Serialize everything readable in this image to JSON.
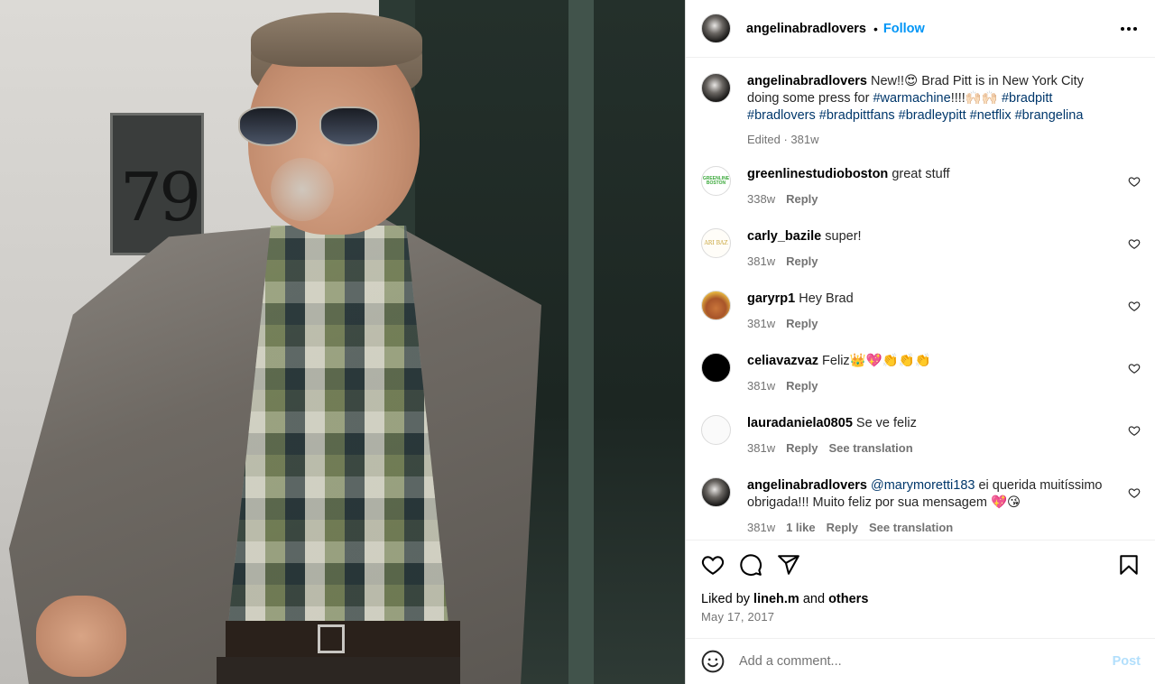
{
  "post": {
    "author": "angelinabradlovers",
    "follow_label": "Follow",
    "dot": "•"
  },
  "caption": {
    "username": "angelinabradlovers",
    "text_start": "New!!😍 Brad Pitt is in New York City doing some press for ",
    "tag1": "#warmachine",
    "text_mid": "!!!!🙌🏻🙌🏻 ",
    "tags_rest": "#bradpitt #bradlovers #bradpittfans #bradleypitt #netflix #brangelina",
    "meta": "Edited · 381w"
  },
  "comments": [
    {
      "username": "greenlinestudioboston",
      "text": "great stuff",
      "age": "338w",
      "reply": "Reply",
      "avatar_text": "GREENLINE BOSTON"
    },
    {
      "username": "carly_bazile",
      "text": "super!",
      "age": "381w",
      "reply": "Reply",
      "avatar_text": "ARI BAZ"
    },
    {
      "username": "garyrp1",
      "text": "Hey Brad",
      "age": "381w",
      "reply": "Reply"
    },
    {
      "username": "celiavazvaz",
      "text": "Feliz👑💖👏👏👏",
      "age": "381w",
      "reply": "Reply"
    },
    {
      "username": "lauradaniela0805",
      "text": "Se ve feliz",
      "age": "381w",
      "reply": "Reply",
      "translate": "See translation"
    },
    {
      "username": "angelinabradlovers",
      "mention": "@marymoretti183",
      "text": " ei querida muitíssimo obrigada!!! Muito feliz por sua mensagem 💖😘",
      "age": "381w",
      "likes": "1 like",
      "reply": "Reply",
      "translate": "See translation"
    }
  ],
  "likes": {
    "prefix": "Liked by ",
    "user": "lineh.m",
    "middle": " and ",
    "others": "others"
  },
  "date": "May 17, 2017",
  "add_comment": {
    "placeholder": "Add a comment...",
    "post_label": "Post"
  },
  "photo": {
    "plaque_number": "79"
  }
}
